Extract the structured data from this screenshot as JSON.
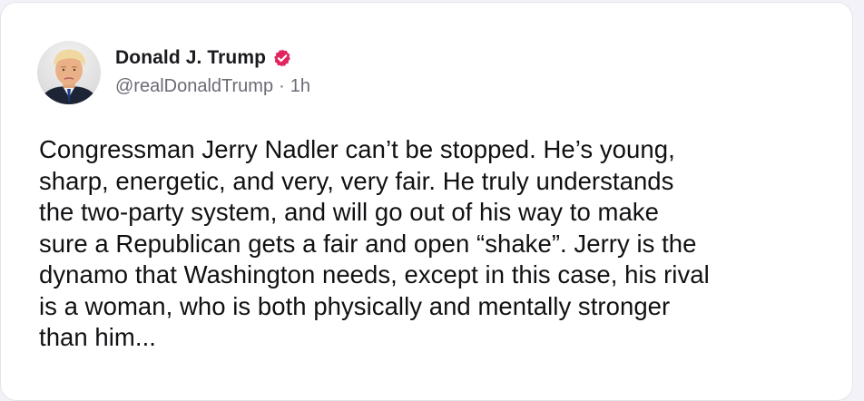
{
  "post": {
    "author": {
      "display_name": "Donald J. Trump",
      "handle": "@realDonaldTrump",
      "avatar_icon": "profile-photo",
      "verified_icon": "verified-badge-icon",
      "verified_color": "#e0245e"
    },
    "separator": "·",
    "time_ago": "1h",
    "text_lines": [
      "Congressman Jerry Nadler can’t be stopped. He’s young,",
      "sharp, energetic, and very, very fair. He truly understands",
      "the two-party system, and will go out of his way to make",
      "sure a Republican gets a fair and open “shake”. Jerry is the",
      "dynamo that Washington needs, except in this case, his rival",
      "is a woman, who is both physically and mentally stronger",
      "than him..."
    ]
  },
  "colors": {
    "page_background": "#f3f2f8",
    "card_background": "#ffffff",
    "text_primary": "#111114",
    "text_secondary": "#6b6a75"
  }
}
